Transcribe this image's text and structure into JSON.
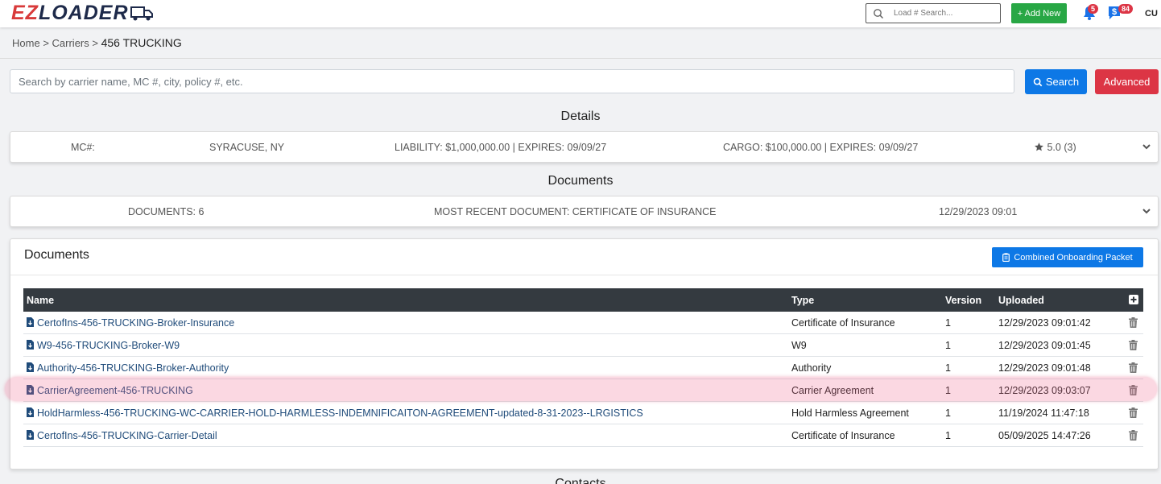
{
  "navbar": {
    "logo_text": "EZLOADER",
    "logo_prefix": "EZ",
    "logo_suffix": "LOADER",
    "search_placeholder": "Load # Search...",
    "add_new_label": "+ Add New",
    "notifications_count": "5",
    "billing_count": "84",
    "user_initials": "CU",
    "icons": [
      "search-icon",
      "bell-icon",
      "dollar-icon",
      "truck-icon"
    ]
  },
  "breadcrumb": {
    "home": "Home",
    "sep1": ">",
    "carriers": "Carriers",
    "sep2": ">",
    "current": "456 TRUCKING"
  },
  "main_search": {
    "placeholder": "Search by carrier name, MC #, city, policy #, etc.",
    "search_label": "Search",
    "advanced_label": "Advanced"
  },
  "details": {
    "heading": "Details",
    "mc": "MC#:",
    "location": "SYRACUSE, NY",
    "liability": "LIABILITY: $1,000,000.00 | EXPIRES: 09/09/27",
    "cargo": "CARGO: $100,000.00 | EXPIRES: 09/09/27",
    "rating": "5.0 (3)"
  },
  "documents_summary": {
    "heading": "Documents",
    "count": "DOCUMENTS: 6",
    "most_recent": "MOST RECENT DOCUMENT: CERTIFICATE OF INSURANCE",
    "date": "12/29/2023 09:01"
  },
  "documents_panel": {
    "title": "Documents",
    "packet_button": "Combined Onboarding Packet",
    "columns": {
      "name": "Name",
      "type": "Type",
      "version": "Version",
      "uploaded": "Uploaded"
    },
    "rows": [
      {
        "name": "CertofIns-456-TRUCKING-Broker-Insurance",
        "type": "Certificate of Insurance",
        "version": "1",
        "uploaded": "12/29/2023 09:01:42"
      },
      {
        "name": "W9-456-TRUCKING-Broker-W9",
        "type": "W9",
        "version": "1",
        "uploaded": "12/29/2023 09:01:45"
      },
      {
        "name": "Authority-456-TRUCKING-Broker-Authority",
        "type": "Authority",
        "version": "1",
        "uploaded": "12/29/2023 09:01:48"
      },
      {
        "name": "CarrierAgreement-456-TRUCKING",
        "type": "Carrier Agreement",
        "version": "1",
        "uploaded": "12/29/2023 09:03:07"
      },
      {
        "name": "HoldHarmless-456-TRUCKING-WC-CARRIER-HOLD-HARMLESS-INDEMNIFICAITON-AGREEMENT-updated-8-31-2023--LRGISTICS",
        "type": "Hold Harmless Agreement",
        "version": "1",
        "uploaded": "11/19/2024 11:47:18"
      },
      {
        "name": "CertofIns-456-TRUCKING-Carrier-Detail",
        "type": "Certificate of Insurance",
        "version": "1",
        "uploaded": "05/09/2025 14:47:26"
      }
    ]
  },
  "bottom_heading": "Contacts",
  "colors": {
    "primary": "#0d78e6",
    "danger": "#dc3545",
    "success": "#28a745",
    "table_header": "#343a40",
    "link": "#1f4b7a",
    "highlight": "#f0648c"
  }
}
